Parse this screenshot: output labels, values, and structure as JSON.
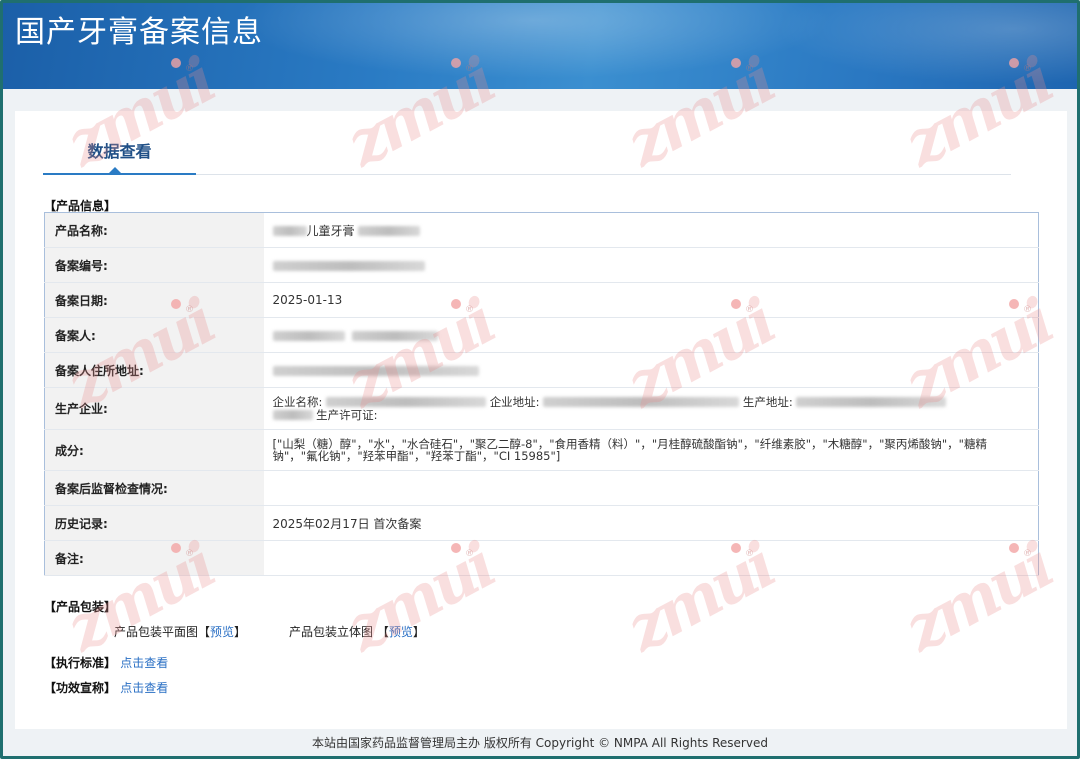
{
  "site": {
    "title": "国产牙膏备案信息"
  },
  "tabs": [
    {
      "label": "数据查看"
    }
  ],
  "product_info": {
    "section_title": "【产品信息】",
    "rows": [
      {
        "label": "产品名称:",
        "value": "儿童牙膏"
      },
      {
        "label": "备案编号:",
        "value": ""
      },
      {
        "label": "备案日期:",
        "value": "2025-01-13"
      },
      {
        "label": "备案人:",
        "value": ""
      },
      {
        "label": "备案人住所地址:",
        "value": ""
      },
      {
        "label": "生产企业:",
        "company_name_label": "企业名称:",
        "company_address_label": "企业地址:",
        "production_address_label": "生产地址:",
        "license_label": "生产许可证:"
      },
      {
        "label": "成分:",
        "value": "[\"山梨（糖）醇\"，\"水\"，\"水合硅石\"，\"聚乙二醇-8\"，\"食用香精（料）\"，\"月桂醇硫酸酯钠\"，\"纤维素胶\"，\"木糖醇\"，\"聚丙烯酸钠\"，\"糖精钠\"，\"氟化钠\"，\"羟苯甲酯\"，\"羟苯丁酯\"，\"CI 15985\"]"
      },
      {
        "label": "备案后监督检查情况:",
        "value": ""
      },
      {
        "label": "历史记录:",
        "value": "2025年02月17日  首次备案"
      },
      {
        "label": "备注:",
        "value": ""
      }
    ]
  },
  "packaging": {
    "section_title": "【产品包装】",
    "flat_label": "产品包装平面图",
    "stereo_label": "产品包装立体图",
    "preview_label": "预览",
    "bracket_open": "【",
    "bracket_close": "】"
  },
  "standard": {
    "section_title": "【执行标准】",
    "link_label": "点击查看"
  },
  "efficacy": {
    "section_title": "【功效宣称】",
    "link_label": "点击查看"
  },
  "footer": {
    "text": "本站由国家药品监督管理局主办 版权所有 Copyright © NMPA All Rights Reserved"
  },
  "watermark": {
    "text": "zmui",
    "reg": "®"
  }
}
